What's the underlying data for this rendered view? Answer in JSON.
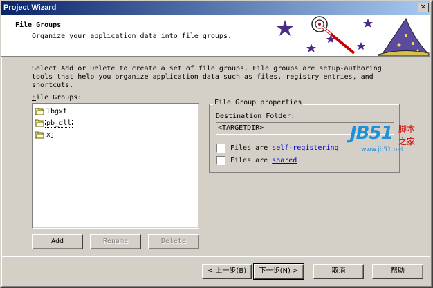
{
  "window": {
    "title": "Project Wizard",
    "close_glyph": "✕"
  },
  "header": {
    "title": "File Groups",
    "subtitle": "Organize your application data into file groups."
  },
  "intro": "Select Add or Delete to create a set of file groups.  File groups are setup-authoring tools that help you organize application data such as files, registry entries, and shortcuts.",
  "file_groups": {
    "label": "File Groups:",
    "items": [
      {
        "label": "lbgxt",
        "icon": "folder-icon"
      },
      {
        "label": "pb_dll",
        "icon": "folder-icon"
      },
      {
        "label": "xj",
        "icon": "folder-icon"
      }
    ],
    "add_label": "Add",
    "rename_label": "Rename",
    "delete_label": "Delete"
  },
  "properties": {
    "group_title": "File Group properties",
    "destination_label": "Destination Folder:",
    "destination_value": "<TARGETDIR>",
    "files_are_label": "Files are",
    "self_registering_link": "self-registering",
    "shared_link": "shared"
  },
  "watermark": {
    "brand": "JB51",
    "cn_top": "脚本",
    "cn_bottom": "之家",
    "url": "www.jb51.net"
  },
  "footer": {
    "back_label": "< 上一步(B)",
    "next_label": "下一步(N) >",
    "cancel_label": "取消",
    "help_label": "帮助"
  },
  "colors": {
    "titlebar_start": "#0a246a",
    "titlebar_end": "#a6caf0",
    "face": "#d4d0c8",
    "link": "#0000cc",
    "watermark_blue": "#1e90d8",
    "watermark_red": "#cc0000"
  }
}
